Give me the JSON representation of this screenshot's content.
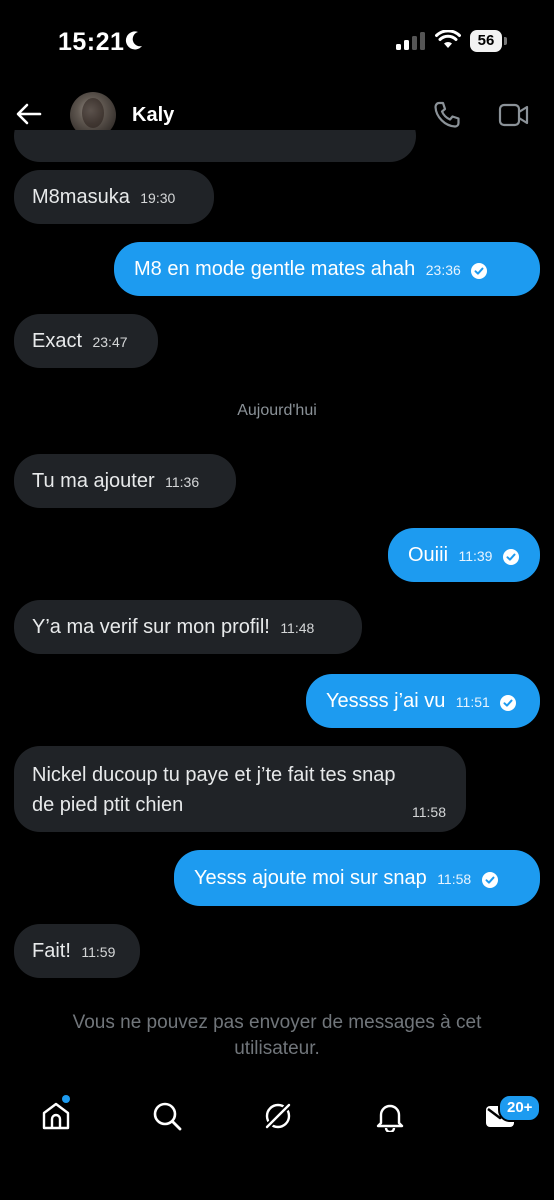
{
  "status_bar": {
    "time": "15:21",
    "battery": "56"
  },
  "header": {
    "contact_name": "Kaly"
  },
  "messages": [
    {
      "side": "recv",
      "text": "M8masuka",
      "time": "19:30"
    },
    {
      "side": "sent",
      "text": "M8 en mode gentle mates ahah",
      "time": "23:36"
    },
    {
      "side": "recv",
      "text": "Exact",
      "time": "23:47"
    },
    {
      "side": "recv",
      "text": "Tu ma ajouter",
      "time": "11:36"
    },
    {
      "side": "sent",
      "text": "Ouiii",
      "time": "11:39"
    },
    {
      "side": "recv",
      "text": "Y’a ma verif sur mon profil!",
      "time": "11:48"
    },
    {
      "side": "sent",
      "text": "Yessss j’ai vu",
      "time": "11:51"
    },
    {
      "side": "recv",
      "text_line1": "Nickel ducoup tu paye et j’te fait tes snap",
      "text_line2": "de pied ptit chien",
      "time": "11:58"
    },
    {
      "side": "sent",
      "text": "Yesss ajoute moi sur snap",
      "time": "11:58"
    },
    {
      "side": "recv",
      "text": "Fait!",
      "time": "11:59"
    }
  ],
  "date_separator": "Aujourd'hui",
  "footer_note": "Vous ne pouvez pas envoyer de messages à cet utilisateur.",
  "tabbar": {
    "messages_badge": "20+"
  },
  "colors": {
    "accent": "#1d9bf0",
    "received_bubble": "#202327",
    "background": "#000000"
  }
}
